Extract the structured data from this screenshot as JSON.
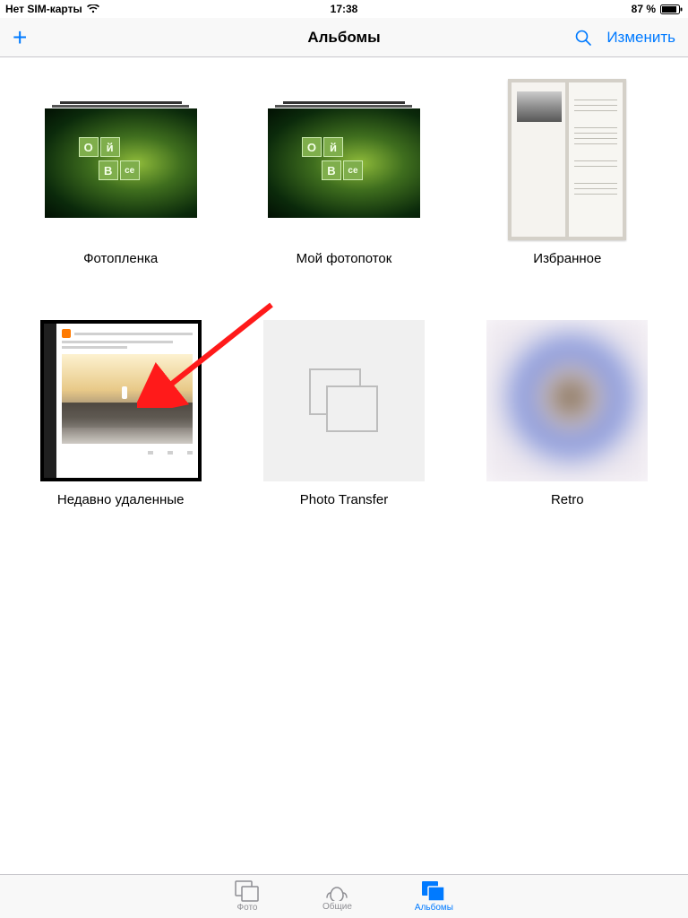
{
  "status": {
    "carrier": "Нет SIM-карты",
    "time": "17:38",
    "battery_pct": "87 %"
  },
  "nav": {
    "title": "Альбомы",
    "edit": "Изменить"
  },
  "albums": [
    {
      "label": "Фотопленка"
    },
    {
      "label": "Мой фотопоток"
    },
    {
      "label": "Избранное"
    },
    {
      "label": "Недавно удаленные"
    },
    {
      "label": "Photo Transfer"
    },
    {
      "label": "Retro"
    }
  ],
  "tabs": {
    "photos": "Фото",
    "shared": "Общие",
    "albums": "Альбомы"
  },
  "colors": {
    "tint": "#007aff",
    "inactive": "#8e8e93"
  }
}
